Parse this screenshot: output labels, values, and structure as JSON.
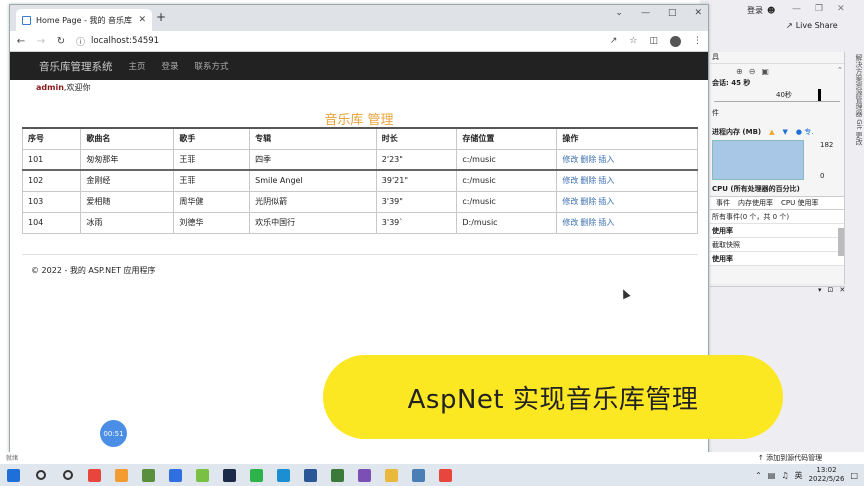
{
  "vs": {
    "login": "登录",
    "share": "Live Share",
    "vtabs": "解决方案资源管理器  Git 更改",
    "session": "会话: 45 秒",
    "timeline_label": "40秒",
    "mem_title": "进程内存 (MB)",
    "mem_legend": "专.",
    "mem_max": "182",
    "mem_min": "0",
    "cpu_title": "CPU (所有处理器的百分比)",
    "tabs": [
      "事件",
      "内存使用率",
      "CPU 使用率"
    ],
    "rows": [
      "所有事件(0 个，共 0 个)",
      "使用率",
      "截取快照",
      "使用率"
    ],
    "row_header_flags": [
      false,
      true,
      false,
      true
    ],
    "status_ready": "就绪",
    "source_control": "添加到源代码管理"
  },
  "browser": {
    "tab_title": "Home Page - 我的 音乐库 管理",
    "url": "localhost:54591"
  },
  "site": {
    "brand": "音乐库管理系统",
    "nav": [
      "主页",
      "登录",
      "联系方式"
    ],
    "welcome_user": "admin",
    "welcome_text": ",欢迎你",
    "heading": "音乐库 管理",
    "columns": [
      "序号",
      "歌曲名",
      "歌手",
      "专辑",
      "时长",
      "存储位置",
      "操作"
    ],
    "rows": [
      [
        "101",
        "匆匆那年",
        "王菲",
        "四季",
        "2'23\"",
        "c:/music"
      ],
      [
        "102",
        "金刚经",
        "王菲",
        "Smile Angel",
        "39'21\"",
        "c:/music"
      ],
      [
        "103",
        "爱相随",
        "周华健",
        "光阴似箭",
        "3'39\"",
        "c:/music"
      ],
      [
        "104",
        "冰雨",
        "刘德华",
        "欢乐中国行",
        "3'39`",
        "D:/music"
      ]
    ],
    "actions": [
      "修改",
      "删除",
      "插入"
    ],
    "footer": "© 2022 - 我的 ASP.NET 应用程序"
  },
  "overlay": {
    "banner": "AspNet 实现音乐库管理",
    "timer": "00:51"
  },
  "taskbar": {
    "time": "13:02",
    "date": "2022/5/26",
    "lang": "英",
    "icons": [
      "windows-start",
      "search",
      "cortana",
      "chrome",
      "app-orange",
      "app-green",
      "app-blue",
      "app-lime",
      "photoshop",
      "wechat",
      "edge",
      "word",
      "app-grid",
      "visual-studio",
      "file-explorer",
      "app-paper",
      "chrome-2"
    ],
    "icon_colors": [
      "#1e6fd9",
      "#333333",
      "#333333",
      "#e8453c",
      "#f39c32",
      "#5a8f3e",
      "#2f6fe0",
      "#7ac143",
      "#1c2a4a",
      "#2db34a",
      "#1b8fd1",
      "#2b5797",
      "#3c7a3c",
      "#7b4fb3",
      "#e8b93c",
      "#4a7fb5",
      "#e8453c"
    ]
  }
}
